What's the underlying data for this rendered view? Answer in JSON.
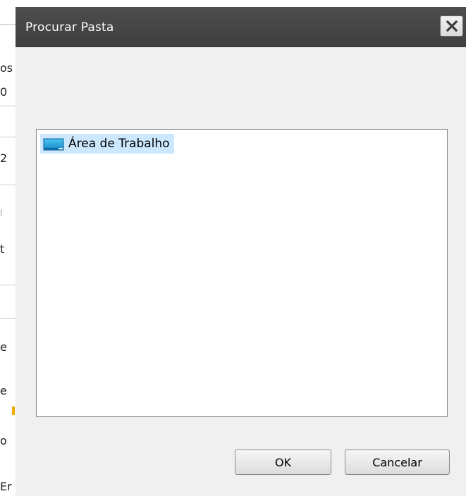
{
  "dialog": {
    "title": "Procurar Pasta",
    "close_icon": "close-icon"
  },
  "tree": {
    "items": [
      {
        "label": "Área de Trabalho",
        "icon": "desktop-icon",
        "selected": true
      }
    ]
  },
  "buttons": {
    "ok_label": "OK",
    "cancel_label": "Cancelar"
  },
  "background": {
    "fragments": [
      "os",
      "0",
      "2",
      "I",
      "t",
      "e",
      "e",
      "o",
      "Er"
    ],
    "top_text": "... ..........."
  },
  "colors": {
    "titlebar": "#444444",
    "selection": "#cce8ff",
    "dialog_bg": "#f0f0f0",
    "icon_blue": "#1fa3e0"
  }
}
